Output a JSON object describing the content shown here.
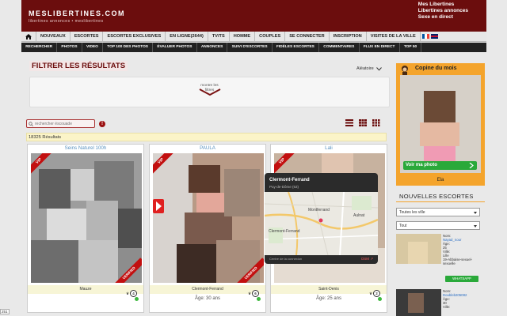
{
  "header": {
    "logo": "MESLIBERTINES.COM",
    "tagline": "libertines annonces • meslibertines",
    "links": [
      "Mes Libertines",
      "Libertines annonces",
      "Sexe en direct"
    ]
  },
  "nav_main": [
    "NOUVEAUX",
    "ESCORTES",
    "ESCORTES EXCLUSIVES",
    "EN LIGNE(2644)",
    "TV/TS",
    "HOMME",
    "COUPLES",
    "SE CONNECTER",
    "INSCRIPTION",
    "VISITES DE LA VILLE"
  ],
  "nav_sub": [
    "RECHERCHER",
    "PHOTOS",
    "VIDEO",
    "TOP 100 DES PHOTOS",
    "ÉVALUER PHOTOS",
    "ANNONCES",
    "SUIVI D'ESCORTES",
    "FIDÈLES ESCORTES",
    "COMMENTAIRES",
    "FLUX EN DIRECT",
    "TOP 50"
  ],
  "filter": {
    "title": "FILTRER LES RÉSULTATS",
    "sort_label": "Aléatoire",
    "show_filters": "montre les filtres"
  },
  "search": {
    "placeholder": "rechercher éscouade"
  },
  "results": "18325 Résultats",
  "cards": [
    {
      "name": "Seins Naturel 100h",
      "city": "Mauze",
      "age": "",
      "count": "4",
      "vip": "VIP",
      "verified": "VERIFIED"
    },
    {
      "name": "PAULA",
      "city": "Clermont-Ferrand",
      "age": "Âge: 30 ans",
      "count": "6",
      "vip": "VIP",
      "verified": "VERIFIED"
    },
    {
      "name": "Lali",
      "city": "Saint-Denis",
      "age": "Âge: 25 ans",
      "count": "2",
      "vip": "VIP",
      "verified": ""
    }
  ],
  "map_popup": {
    "city": "Clermont-Ferrand",
    "region": "Puy-de-Dôme (63)",
    "footer_left": "Centre de la connexion",
    "footer_right": "OSM ↗",
    "labels": [
      "Montferrand",
      "Clermont-Ferrand",
      "Aulnat"
    ]
  },
  "sidebar": {
    "copine_title": "Copine du mois",
    "see_profile": "Voir ma photo",
    "copine_name": "Ela",
    "new_title": "NOUVELLES ESCORTES",
    "select_city": "Toutes les ville",
    "select_type": "Tout",
    "escorts": [
      {
        "lines": [
          "Nom:",
          "Nayad_nour",
          "Âge:",
          "25",
          "Ville:",
          "Lille",
          "19-Abbaise-sexuel-sexuelle"
        ],
        "whatsapp": "WHATSAPP"
      },
      {
        "lines": [
          "Nom:",
          "Doubleb205082",
          "Âge:",
          "30",
          "Ville:"
        ],
        "whatsapp": ""
      }
    ]
  },
  "bottom_badge": "251",
  "colors": {
    "brand": "#6b0d0d",
    "accent": "#f4a42c",
    "link": "#5a92c0",
    "success": "#2aa93a",
    "vip": "#c20f0f"
  }
}
